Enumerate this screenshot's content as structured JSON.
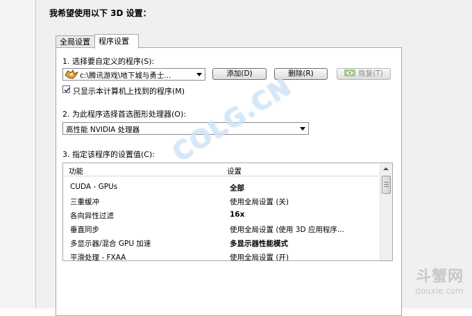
{
  "heading": "我希望使用以下 3D 设置：",
  "tabs": [
    {
      "label": "全局设置",
      "active": false
    },
    {
      "label": "程序设置",
      "active": true
    }
  ],
  "section1": {
    "label": "1. 选择要自定义的程序(S):",
    "program_value": "c:\\腾讯游戏\\地下城与勇士...",
    "add_button": "添加(D)",
    "delete_button": "删除(R)",
    "restore_button": "恢复(T)",
    "checkbox_label": "只显示本计算机上找到的程序(M)",
    "checkbox_checked": true
  },
  "section2": {
    "label": "2. 为此程序选择首选图形处理器(O):",
    "gpu_value": "高性能 NVIDIA 处理器"
  },
  "section3": {
    "label": "3. 指定该程序的设置值(C):",
    "columns": [
      "功能",
      "设置"
    ],
    "rows": [
      {
        "feature": "CUDA - GPUs",
        "setting": "全部",
        "bold": true
      },
      {
        "feature": "三重缓冲",
        "setting": "使用全局设置 (关)",
        "bold": false
      },
      {
        "feature": "各向异性过滤",
        "setting": "16x",
        "bold": true
      },
      {
        "feature": "垂直同步",
        "setting": "使用全局设置 (使用 3D 应用程序...",
        "bold": false
      },
      {
        "feature": "多显示器/混合 GPU 加速",
        "setting": "多显示器性能模式",
        "bold": true
      },
      {
        "feature": "平滑处理 - FXAA",
        "setting": "使用全局设置 (开)",
        "bold": false
      }
    ]
  },
  "watermarks": {
    "center": "COLG.CN",
    "corner_logo": "斗蟹网",
    "corner_url": "douxie.com"
  },
  "colors": {
    "panel_bg": "#f0f0f0",
    "tab_body_bg": "#ffffff",
    "border": "#a8a8a8"
  }
}
